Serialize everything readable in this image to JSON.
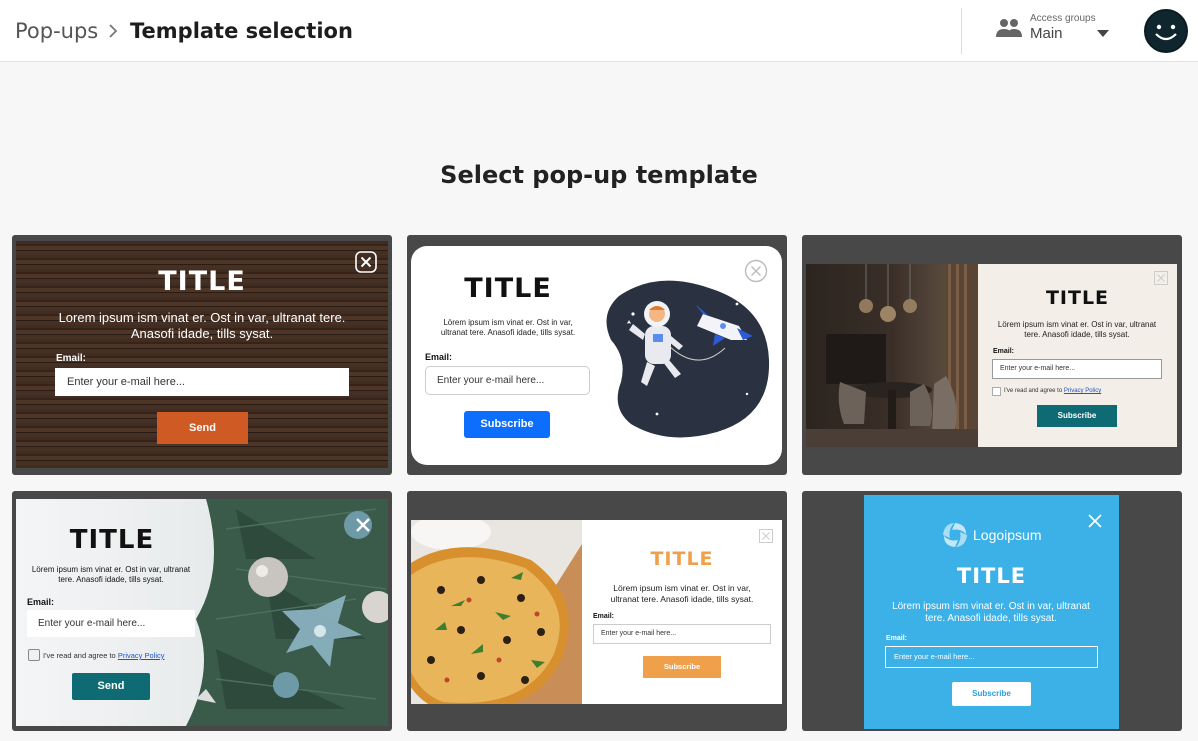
{
  "breadcrumb": {
    "root": "Pop-ups",
    "current": "Template selection"
  },
  "access_groups": {
    "label": "Access groups",
    "value": "Main"
  },
  "heading": "Select pop-up template",
  "templates": [
    {
      "title": "TITLE",
      "text": "Lorem ipsum ism vinat er. Ost in var, ultranat tere. Anasofi idade, tills sysat.",
      "email_label": "Email:",
      "placeholder": "Enter your e-mail here...",
      "button": "Send"
    },
    {
      "title": "TITLE",
      "text": "Lörem ipsum ism vinat er. Ost in var, ultranat tere. Anasofi idade, tills sysat.",
      "email_label": "Email:",
      "placeholder": "Enter your e-mail here...",
      "button": "Subscribe"
    },
    {
      "title": "TITLE",
      "text": "Lörem ipsum ism vinat er. Ost in var, ultranat tere. Anasofi idade, tills sysat.",
      "email_label": "Email:",
      "placeholder": "Enter your e-mail here...",
      "consent": "I've read and agree to",
      "policy": "Privacy Policy",
      "button": "Subscribe"
    },
    {
      "title": "TITLE",
      "text": "Lörem ipsum ism vinat er. Ost in var, ultranat tere. Anasofi idade, tills sysat.",
      "email_label": "Email:",
      "placeholder": "Enter your e-mail here...",
      "consent": "I've read and agree to",
      "policy": "Privacy Policy",
      "button": "Send"
    },
    {
      "title": "TITLE",
      "text": "Lörem ipsum ism vinat er. Ost in var, ultranat tere. Anasofi idade, tills sysat.",
      "email_label": "Email:",
      "placeholder": "Enter your e-mail here...",
      "button": "Subscribe"
    },
    {
      "logo": "Logoipsum",
      "title": "TITLE",
      "text": "Lörem ipsum ism vinat er. Ost in var, ultranat tere. Anasofi idade, tills sysat.",
      "email_label": "Email:",
      "placeholder": "Enter your e-mail here...",
      "button": "Subscribe"
    }
  ],
  "colors": {
    "send_orange": "#cf5a24",
    "subscribe_blue": "#0d6efd",
    "teal": "#0f6b73",
    "pizza_orange": "#f0a04b",
    "sky_blue": "#3bb1e8"
  }
}
